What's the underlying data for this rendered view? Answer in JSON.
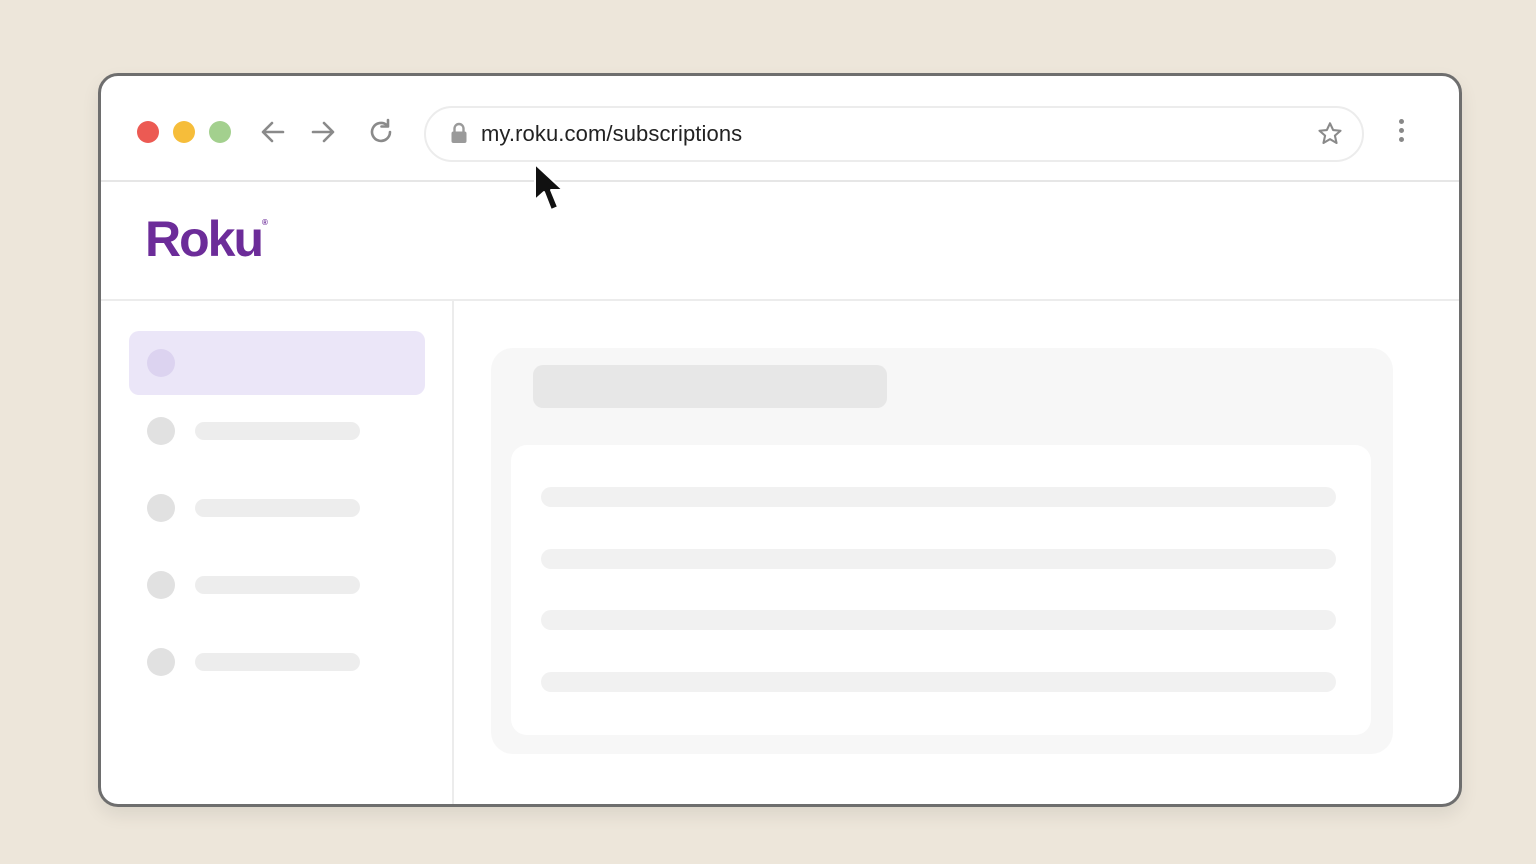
{
  "browser": {
    "url": "my.roku.com/subscriptions",
    "icons": [
      "close-dot",
      "minimize-dot",
      "maximize-dot",
      "back-arrow-icon",
      "forward-arrow-icon",
      "reload-icon",
      "lock-icon",
      "star-icon",
      "kebab-menu-icon"
    ]
  },
  "site": {
    "logo_text": "Roku",
    "brand_color": "#6c2c99"
  },
  "sidebar": {
    "item_count": 5,
    "active_index": 0
  },
  "content": {
    "placeholder_lines": 4
  }
}
